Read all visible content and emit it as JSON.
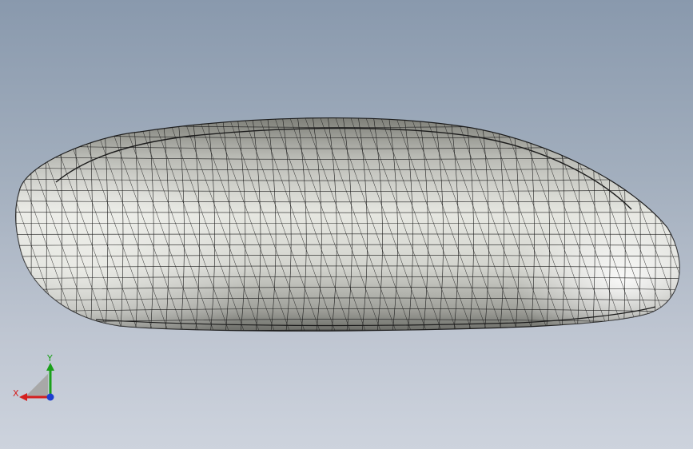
{
  "viewport": {
    "background_top": "#8999ad",
    "background_bottom": "#cdd3dd",
    "model": {
      "name": "mouse-shell-wireframe",
      "display_mode": "shaded-with-edges",
      "fill_color": "#e8e9e4",
      "edge_color": "#1c1c1c"
    },
    "triad": {
      "x_label": "X",
      "y_label": "Y",
      "x_color": "#d42020",
      "y_color": "#1aa01a",
      "z_color": "#1e3fd0"
    }
  }
}
